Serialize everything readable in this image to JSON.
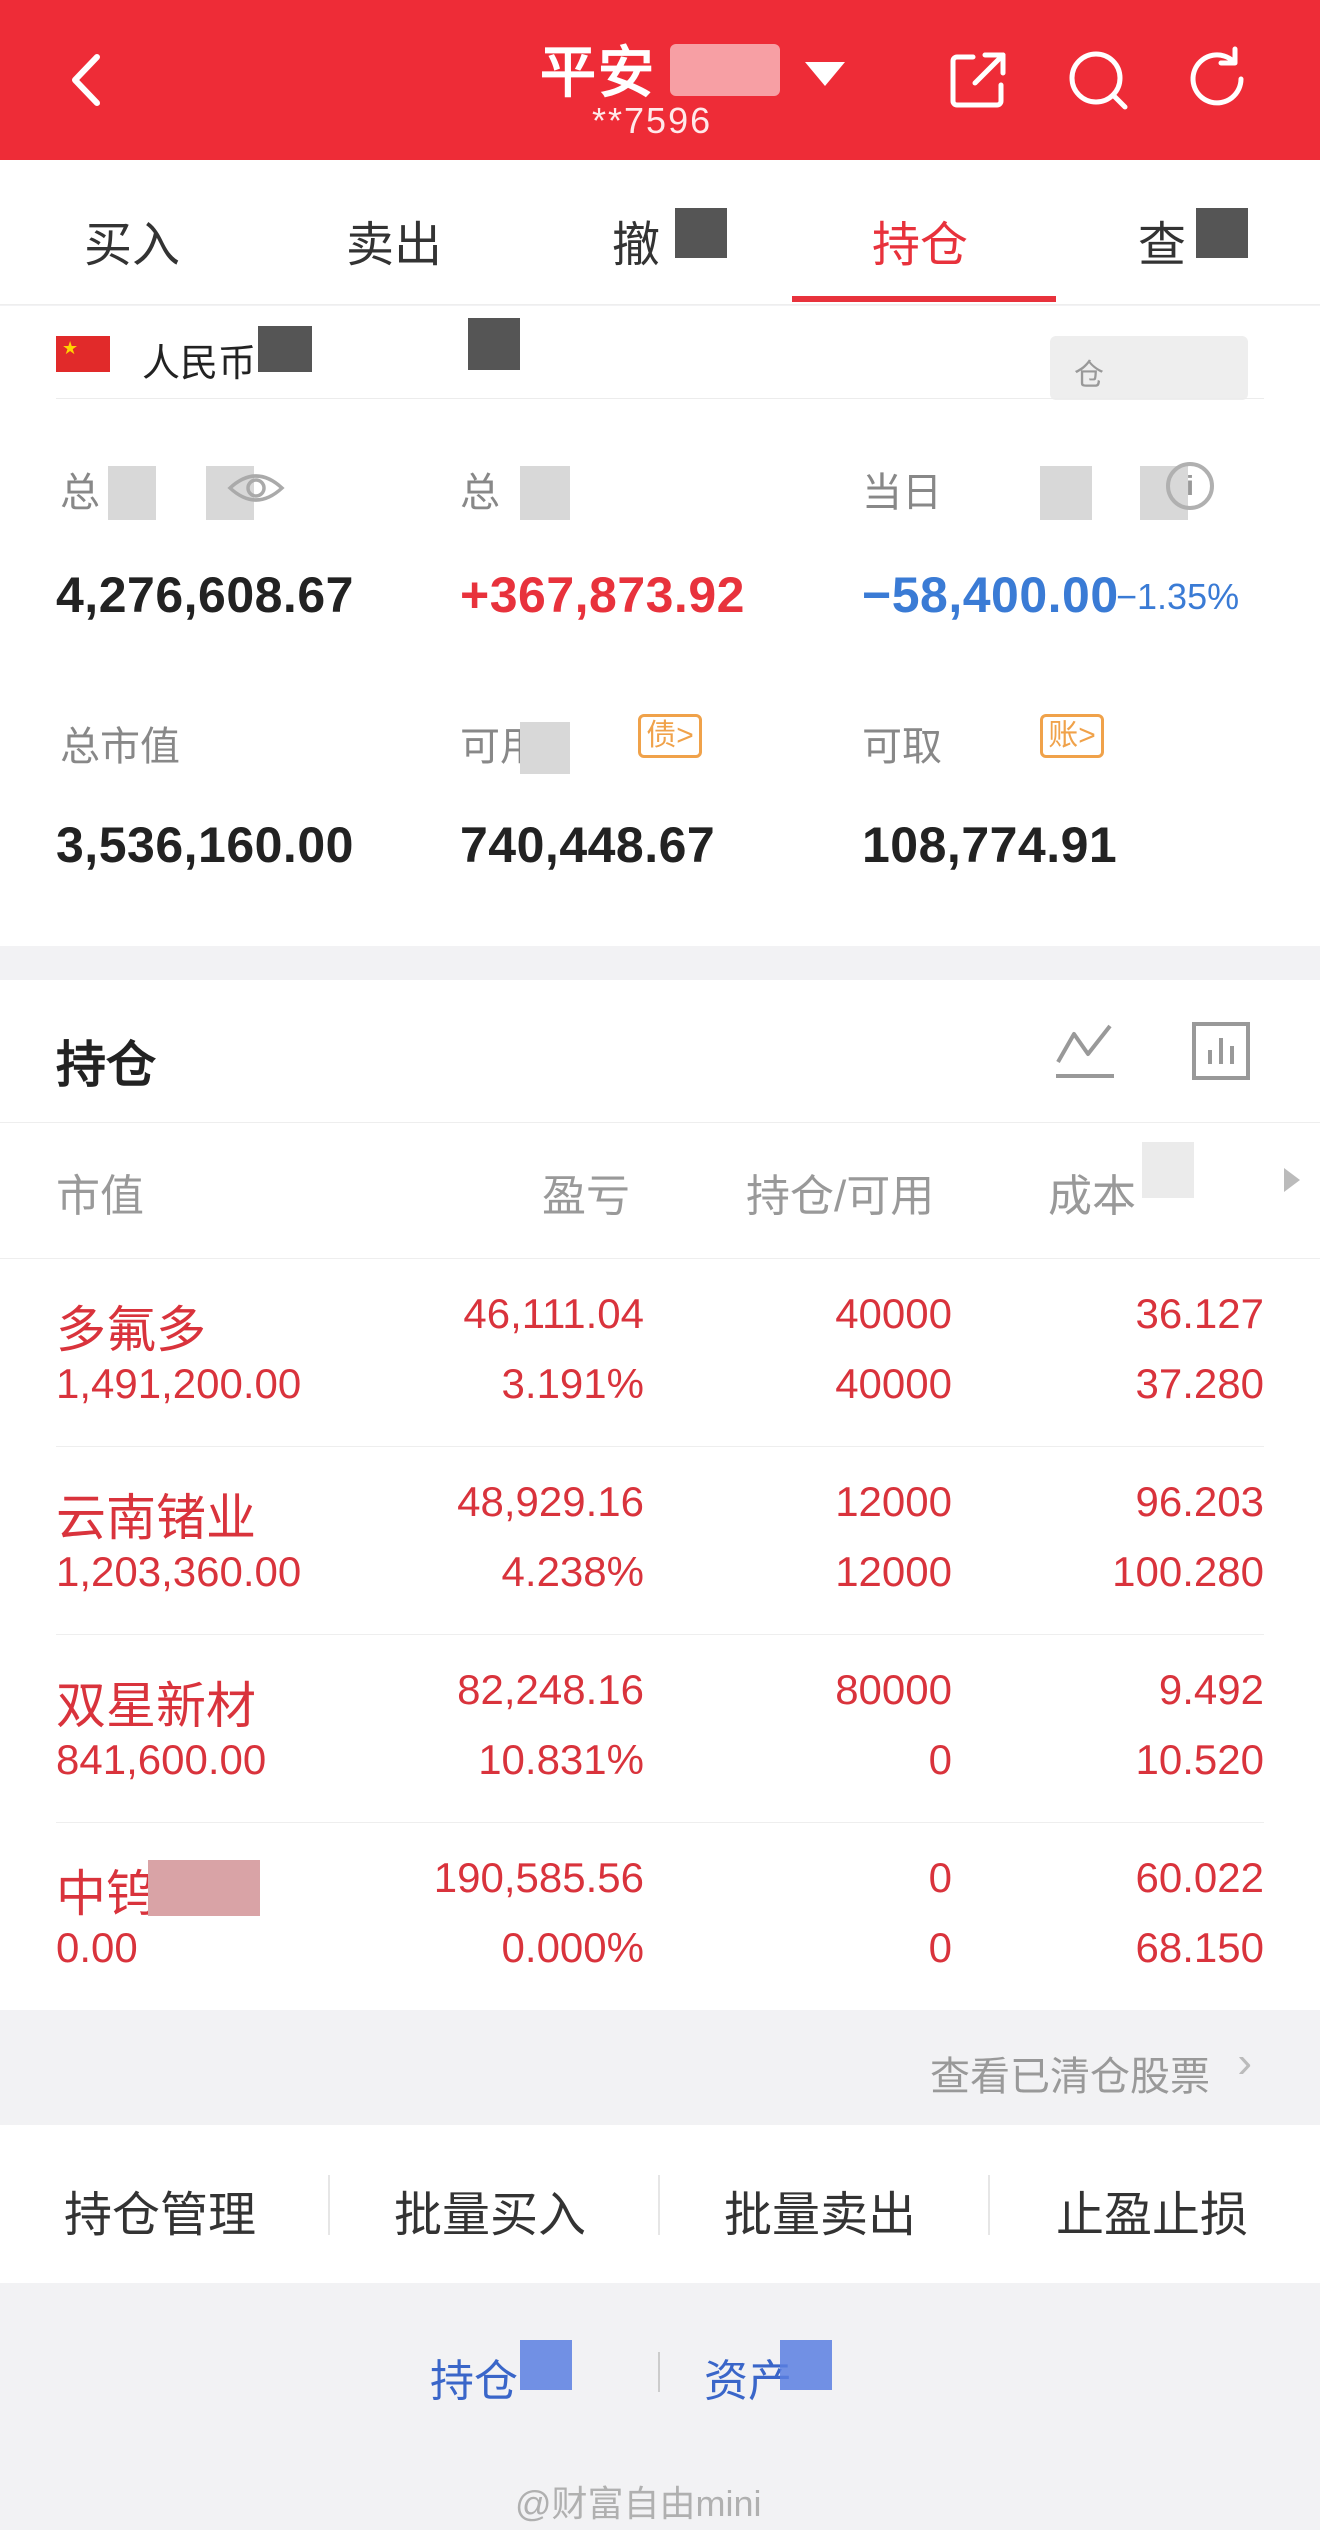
{
  "header": {
    "title": "平安",
    "account": "**7596"
  },
  "tabs": [
    "买入",
    "卖出",
    "撤",
    "持仓",
    "查"
  ],
  "summary": {
    "currency": "人民币",
    "position_button": "仓",
    "stats_row1": [
      {
        "label": "总",
        "value": "4,276,608.67"
      },
      {
        "label": "总",
        "value": "+367,873.92"
      },
      {
        "label": "当日",
        "value": "−58,400.00",
        "pct": "−1.35%"
      }
    ],
    "stats_row2": [
      {
        "label": "总市值",
        "value": "3,536,160.00"
      },
      {
        "label": "可用",
        "value": "740,448.67",
        "tag": "债>"
      },
      {
        "label": "可取",
        "value": "108,774.91",
        "tag": "账>"
      }
    ]
  },
  "holdings": {
    "title": "持仓",
    "columns": [
      "市值",
      "盈亏",
      "持仓/可用",
      "成本"
    ],
    "rows": [
      {
        "name": "多氟多",
        "market_value": "1,491,200.00",
        "pnl": "46,111.04",
        "pnl_pct": "3.191%",
        "holding": "40000",
        "available": "40000",
        "cost": "36.127",
        "price": "37.280"
      },
      {
        "name": "云南锗业",
        "market_value": "1,203,360.00",
        "pnl": "48,929.16",
        "pnl_pct": "4.238%",
        "holding": "12000",
        "available": "12000",
        "cost": "96.203",
        "price": "100.280"
      },
      {
        "name": "双星新材",
        "market_value": "841,600.00",
        "pnl": "82,248.16",
        "pnl_pct": "10.831%",
        "holding": "80000",
        "available": "0",
        "cost": "9.492",
        "price": "10.520"
      },
      {
        "name": "中钨高新",
        "market_value": "0.00",
        "pnl": "190,585.56",
        "pnl_pct": "0.000%",
        "holding": "0",
        "available": "0",
        "cost": "60.022",
        "price": "68.150"
      }
    ],
    "view_cleared": "查看已清仓股票"
  },
  "actions": [
    "持仓管理",
    "批量买入",
    "批量卖出",
    "止盈止损"
  ],
  "footer": {
    "link1": "持仓",
    "link2": "资产",
    "watermark": "@财富自由mini"
  },
  "colors": {
    "brand_red": "#ee2c37",
    "profit_red": "#d9333c",
    "loss_blue": "#3a7bd5"
  }
}
